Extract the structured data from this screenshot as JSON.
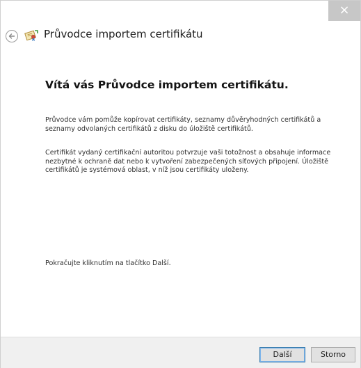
{
  "window": {
    "close_glyph": "×"
  },
  "header": {
    "title": "Průvodce importem certifikátu",
    "back_icon": "back-arrow-icon",
    "wizard_icon": "certificate-icon"
  },
  "content": {
    "heading": "Vítá vás Průvodce importem certifikátu.",
    "paragraph1": "Průvodce vám pomůže kopírovat certifikáty, seznamy důvěryhodných certifikátů a seznamy odvolaných certifikátů z disku do úložiště certifikátů.",
    "paragraph2": "Certifikát vydaný certifikační autoritou potvrzuje vaši totožnost a obsahuje informace nezbytné k ochraně dat nebo k vytvoření zabezpečených síťových připojení. Úložiště certifikátů je systémová oblast, v níž jsou certifikáty uloženy.",
    "paragraph3": "Pokračujte kliknutím na tlačítko Další."
  },
  "footer": {
    "next_label": "Další",
    "cancel_label": "Storno"
  },
  "colors": {
    "close_button_bg": "#c7c7c7",
    "footer_bg": "#f0f0f0",
    "default_button_border": "#3c7fb1"
  }
}
